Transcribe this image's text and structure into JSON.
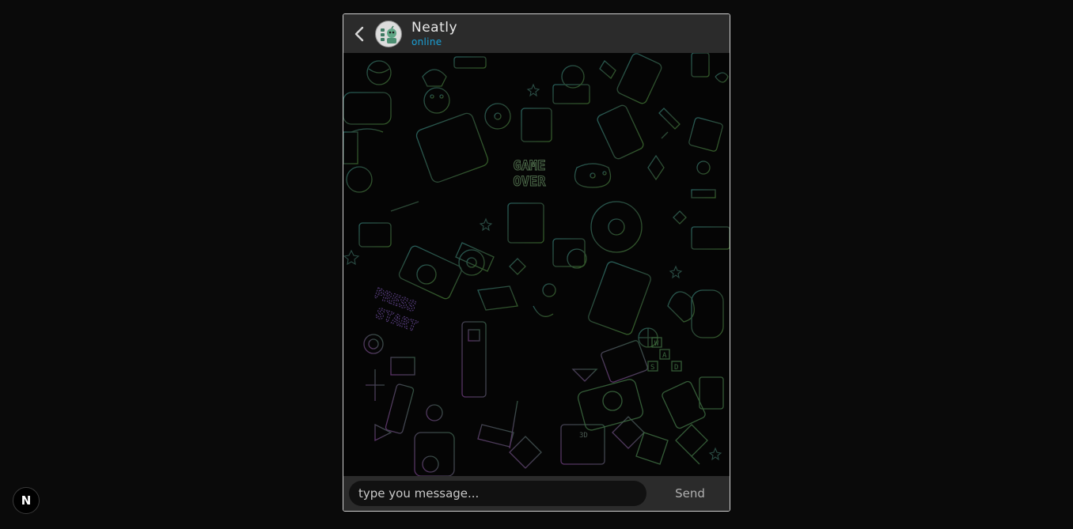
{
  "header": {
    "name": "Neatly",
    "status": "online"
  },
  "composer": {
    "placeholder": "type you message...",
    "send_label": "Send"
  },
  "wallpaper": {
    "game_over_text": "GAME OVER",
    "press_start_text": "PRESS START",
    "wasd_keys": [
      "W",
      "A",
      "S",
      "D"
    ],
    "device_label": "3D"
  },
  "dev_badge": {
    "label": "N"
  },
  "colors": {
    "accent_status": "#1aa0d6",
    "header_bg": "#2b2b2b",
    "page_bg": "#0a0a0a"
  }
}
